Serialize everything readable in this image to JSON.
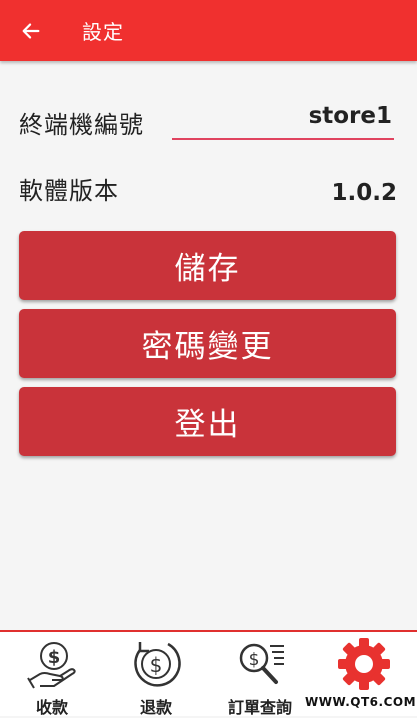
{
  "header": {
    "title": "設定",
    "back_icon": "arrow-left-icon",
    "bg_color": "#f0302f"
  },
  "settings": {
    "terminal_label": "終端機編號",
    "terminal_value": "store1",
    "version_label": "軟體版本",
    "version_value": "1.0.2"
  },
  "buttons": {
    "save_label": "儲存",
    "change_password_label": "密碼變更",
    "logout_label": "登出",
    "color": "#c9333a"
  },
  "bottom_nav": {
    "items": [
      {
        "label": "收款",
        "icon": "hand-dollar-icon"
      },
      {
        "label": "退款",
        "icon": "dollar-refund-icon"
      },
      {
        "label": "訂單查詢",
        "icon": "order-search-icon"
      },
      {
        "label": "",
        "icon": "gear-icon"
      }
    ],
    "active_color": "#e8322f"
  },
  "watermark": "WWW.QT6.COM"
}
